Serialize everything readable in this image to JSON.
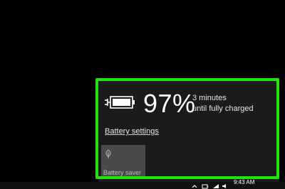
{
  "battery_flyout": {
    "percent": "97%",
    "time_line1": "3 minutes",
    "time_line2": "until fully charged",
    "settings_link": "Battery settings",
    "saver_tile_label": "Battery saver",
    "charge_level": 0.97,
    "icon": "battery-charging-icon",
    "saver_icon": "leaf-icon"
  },
  "highlight": {
    "color": "#22e40c"
  },
  "taskbar": {
    "clock_time": "9:43 AM",
    "tray_icons": [
      "chevron-up-icon",
      "battery-icon",
      "network-icon",
      "volume-icon"
    ]
  }
}
